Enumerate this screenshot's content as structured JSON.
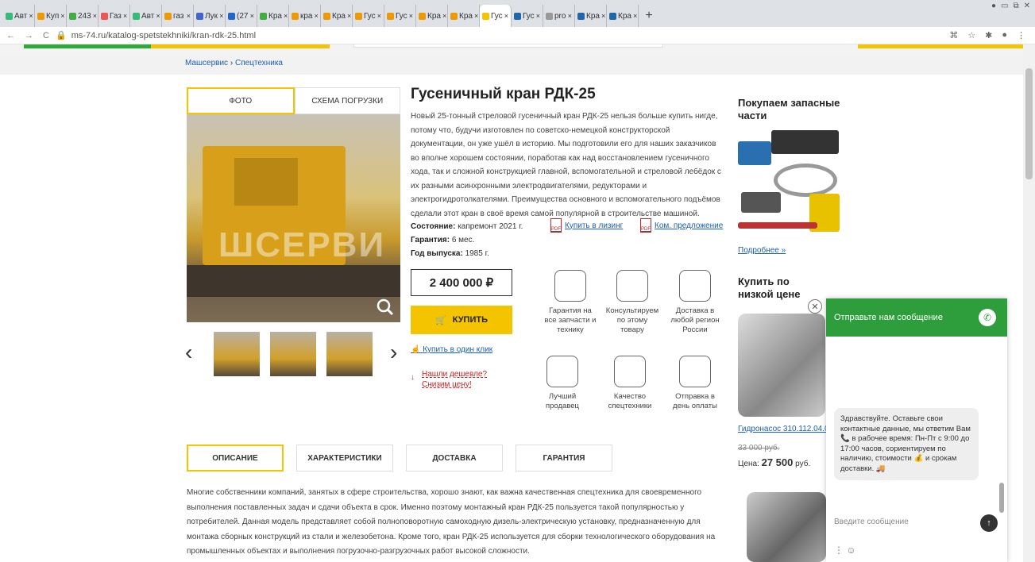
{
  "browser": {
    "tabs": [
      "Авт",
      "Куп",
      "243",
      "Газ",
      "Авт",
      "газ",
      "Лук",
      "(27",
      "Кра",
      "кра",
      "Кра",
      "Гус",
      "Гус",
      "Кра",
      "Кра",
      "Гус",
      "Гус",
      "pro",
      "Кра",
      "Кра"
    ],
    "active_tab_index": 15,
    "url": "ms-74.ru/katalog-spetstekhniki/kran-rdk-25.html"
  },
  "breadcrumb": {
    "home": "Машсервис",
    "sep": "›",
    "current": "Спецтехника"
  },
  "product": {
    "view_tabs": [
      "ФОТО",
      "СХЕМА ПОГРУЗКИ"
    ],
    "title": "Гусеничный кран РДК-25",
    "description": "Новый 25-тонный стреловой гусеничный кран РДК-25 нельзя больше купить нигде, потому что, будучи изготовлен по советско-немецкой конструкторской документации, он уже ушёл в историю. Мы подготовили его для наших заказчиков во вполне хорошем состоянии, поработав как над восстановлением гусеничного хода, так и сложной конструкцией главной, вспомогательной и стреловой лебёдок с их разными асинхронными электродвигателями, редукторами и электрогидротолкателями. Преимущества основного и вспомогательного подъёмов сделали этот кран в своё время самой популярной в строительстве машиной.",
    "specs": [
      {
        "label": "Состояние:",
        "value": "капремонт 2021 г."
      },
      {
        "label": "Гарантия:",
        "value": "6 мес."
      },
      {
        "label": "Год выпуска:",
        "value": "1985 г."
      }
    ],
    "leasing_link": "Купить в лизинг",
    "offer_link": "Ком. предложение",
    "pdf_label": "PDF",
    "price": "2 400 000 ₽",
    "buy_label": "КУПИТЬ",
    "one_click": "Купить в один клик",
    "cheaper_1": "Нашли дешевле?",
    "cheaper_2": "Снизим цену!",
    "photo_watermark": "ШСЕРВИ"
  },
  "features": [
    {
      "icon": "shield-icon",
      "text": "Гарантия на все запчасти и технику"
    },
    {
      "icon": "headset-icon",
      "text": "Консультируем по этому товару"
    },
    {
      "icon": "plane-icon",
      "text": "Доставка в любой регион России"
    },
    {
      "icon": "stars-person-icon",
      "text": "Лучший продавец"
    },
    {
      "icon": "medal-icon",
      "text": "Качество спецтехники"
    },
    {
      "icon": "container-icon",
      "text": "Отправка в день оплаты"
    }
  ],
  "sidebar": {
    "buy_parts_title": "Покупаем запасные части",
    "more_link": "Подробнее »",
    "low_price_title": "Купить по низкой цене",
    "product_link": "Гидронасос 310.112.04.06",
    "old_price": "33 000 руб.",
    "new_price_label": "Цена:",
    "new_price": "27 500",
    "currency": "руб."
  },
  "detail_tabs": [
    "ОПИСАНИЕ",
    "ХАРАКТЕРИСТИКИ",
    "ДОСТАВКА",
    "ГАРАНТИЯ"
  ],
  "long_description": "Многие собственники компаний, занятых в сфере строительства, хорошо знают, как важна качественная спецтехника для своевременного выполнения поставленных задач и сдачи объекта в срок. Именно поэтому монтажный кран РДК-25 пользуется такой популярностью у потребителей. Данная модель представляет собой полноповоротную самоходную дизель-электрическую установку, предназначенную для монтажа сборных конструкций из стали и железобетона. Кроме того, кран РДК-25 используется для сборки технологического оборудования на промышленных объектах и выполнения погрузочно-разгрузочных работ высокой сложности.",
  "chat": {
    "header": "Отправьте нам сообщение",
    "message": "Здравствуйте. Оставьте свои контактные данные, мы ответим Вам 📞 в рабочее время: Пн-Пт с 9:00 до 17:00 часов, сориентируем по наличию, стоимости 💰 и срокам доставки. 🚚",
    "input_placeholder": "Введите сообщение"
  },
  "colors": {
    "accent": "#f5c400",
    "link": "#1a5fb4",
    "chat_green": "#2e9e3c",
    "alert": "#cc2222"
  }
}
